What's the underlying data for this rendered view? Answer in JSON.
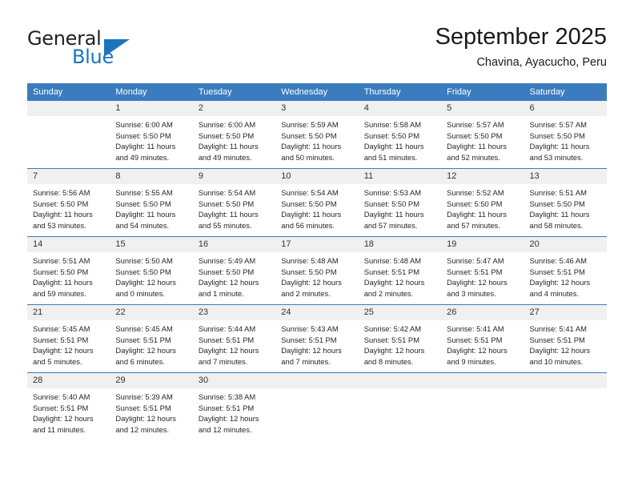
{
  "brand": {
    "word_one": "General",
    "word_two": "Blue",
    "triangle": "blue-triangle-icon"
  },
  "header": {
    "title": "September 2025",
    "subtitle": "Chavina, Ayacucho, Peru"
  },
  "colors": {
    "header_blue": "#3a7cbe",
    "brand_blue": "#1b75bb",
    "daynum_band": "#f0f0f0",
    "text": "#262626"
  },
  "weekday_headers": [
    "Sunday",
    "Monday",
    "Tuesday",
    "Wednesday",
    "Thursday",
    "Friday",
    "Saturday"
  ],
  "weeks": [
    [
      {
        "day": "",
        "empty": true
      },
      {
        "day": "1",
        "sunrise": "Sunrise: 6:00 AM",
        "sunset": "Sunset: 5:50 PM",
        "daylight": "Daylight: 11 hours and 49 minutes."
      },
      {
        "day": "2",
        "sunrise": "Sunrise: 6:00 AM",
        "sunset": "Sunset: 5:50 PM",
        "daylight": "Daylight: 11 hours and 49 minutes."
      },
      {
        "day": "3",
        "sunrise": "Sunrise: 5:59 AM",
        "sunset": "Sunset: 5:50 PM",
        "daylight": "Daylight: 11 hours and 50 minutes."
      },
      {
        "day": "4",
        "sunrise": "Sunrise: 5:58 AM",
        "sunset": "Sunset: 5:50 PM",
        "daylight": "Daylight: 11 hours and 51 minutes."
      },
      {
        "day": "5",
        "sunrise": "Sunrise: 5:57 AM",
        "sunset": "Sunset: 5:50 PM",
        "daylight": "Daylight: 11 hours and 52 minutes."
      },
      {
        "day": "6",
        "sunrise": "Sunrise: 5:57 AM",
        "sunset": "Sunset: 5:50 PM",
        "daylight": "Daylight: 11 hours and 53 minutes."
      }
    ],
    [
      {
        "day": "7",
        "sunrise": "Sunrise: 5:56 AM",
        "sunset": "Sunset: 5:50 PM",
        "daylight": "Daylight: 11 hours and 53 minutes."
      },
      {
        "day": "8",
        "sunrise": "Sunrise: 5:55 AM",
        "sunset": "Sunset: 5:50 PM",
        "daylight": "Daylight: 11 hours and 54 minutes."
      },
      {
        "day": "9",
        "sunrise": "Sunrise: 5:54 AM",
        "sunset": "Sunset: 5:50 PM",
        "daylight": "Daylight: 11 hours and 55 minutes."
      },
      {
        "day": "10",
        "sunrise": "Sunrise: 5:54 AM",
        "sunset": "Sunset: 5:50 PM",
        "daylight": "Daylight: 11 hours and 56 minutes."
      },
      {
        "day": "11",
        "sunrise": "Sunrise: 5:53 AM",
        "sunset": "Sunset: 5:50 PM",
        "daylight": "Daylight: 11 hours and 57 minutes."
      },
      {
        "day": "12",
        "sunrise": "Sunrise: 5:52 AM",
        "sunset": "Sunset: 5:50 PM",
        "daylight": "Daylight: 11 hours and 57 minutes."
      },
      {
        "day": "13",
        "sunrise": "Sunrise: 5:51 AM",
        "sunset": "Sunset: 5:50 PM",
        "daylight": "Daylight: 11 hours and 58 minutes."
      }
    ],
    [
      {
        "day": "14",
        "sunrise": "Sunrise: 5:51 AM",
        "sunset": "Sunset: 5:50 PM",
        "daylight": "Daylight: 11 hours and 59 minutes."
      },
      {
        "day": "15",
        "sunrise": "Sunrise: 5:50 AM",
        "sunset": "Sunset: 5:50 PM",
        "daylight": "Daylight: 12 hours and 0 minutes."
      },
      {
        "day": "16",
        "sunrise": "Sunrise: 5:49 AM",
        "sunset": "Sunset: 5:50 PM",
        "daylight": "Daylight: 12 hours and 1 minute."
      },
      {
        "day": "17",
        "sunrise": "Sunrise: 5:48 AM",
        "sunset": "Sunset: 5:50 PM",
        "daylight": "Daylight: 12 hours and 2 minutes."
      },
      {
        "day": "18",
        "sunrise": "Sunrise: 5:48 AM",
        "sunset": "Sunset: 5:51 PM",
        "daylight": "Daylight: 12 hours and 2 minutes."
      },
      {
        "day": "19",
        "sunrise": "Sunrise: 5:47 AM",
        "sunset": "Sunset: 5:51 PM",
        "daylight": "Daylight: 12 hours and 3 minutes."
      },
      {
        "day": "20",
        "sunrise": "Sunrise: 5:46 AM",
        "sunset": "Sunset: 5:51 PM",
        "daylight": "Daylight: 12 hours and 4 minutes."
      }
    ],
    [
      {
        "day": "21",
        "sunrise": "Sunrise: 5:45 AM",
        "sunset": "Sunset: 5:51 PM",
        "daylight": "Daylight: 12 hours and 5 minutes."
      },
      {
        "day": "22",
        "sunrise": "Sunrise: 5:45 AM",
        "sunset": "Sunset: 5:51 PM",
        "daylight": "Daylight: 12 hours and 6 minutes."
      },
      {
        "day": "23",
        "sunrise": "Sunrise: 5:44 AM",
        "sunset": "Sunset: 5:51 PM",
        "daylight": "Daylight: 12 hours and 7 minutes."
      },
      {
        "day": "24",
        "sunrise": "Sunrise: 5:43 AM",
        "sunset": "Sunset: 5:51 PM",
        "daylight": "Daylight: 12 hours and 7 minutes."
      },
      {
        "day": "25",
        "sunrise": "Sunrise: 5:42 AM",
        "sunset": "Sunset: 5:51 PM",
        "daylight": "Daylight: 12 hours and 8 minutes."
      },
      {
        "day": "26",
        "sunrise": "Sunrise: 5:41 AM",
        "sunset": "Sunset: 5:51 PM",
        "daylight": "Daylight: 12 hours and 9 minutes."
      },
      {
        "day": "27",
        "sunrise": "Sunrise: 5:41 AM",
        "sunset": "Sunset: 5:51 PM",
        "daylight": "Daylight: 12 hours and 10 minutes."
      }
    ],
    [
      {
        "day": "28",
        "sunrise": "Sunrise: 5:40 AM",
        "sunset": "Sunset: 5:51 PM",
        "daylight": "Daylight: 12 hours and 11 minutes."
      },
      {
        "day": "29",
        "sunrise": "Sunrise: 5:39 AM",
        "sunset": "Sunset: 5:51 PM",
        "daylight": "Daylight: 12 hours and 12 minutes."
      },
      {
        "day": "30",
        "sunrise": "Sunrise: 5:38 AM",
        "sunset": "Sunset: 5:51 PM",
        "daylight": "Daylight: 12 hours and 12 minutes."
      },
      {
        "day": "",
        "empty": true
      },
      {
        "day": "",
        "empty": true
      },
      {
        "day": "",
        "empty": true
      },
      {
        "day": "",
        "empty": true
      }
    ]
  ]
}
